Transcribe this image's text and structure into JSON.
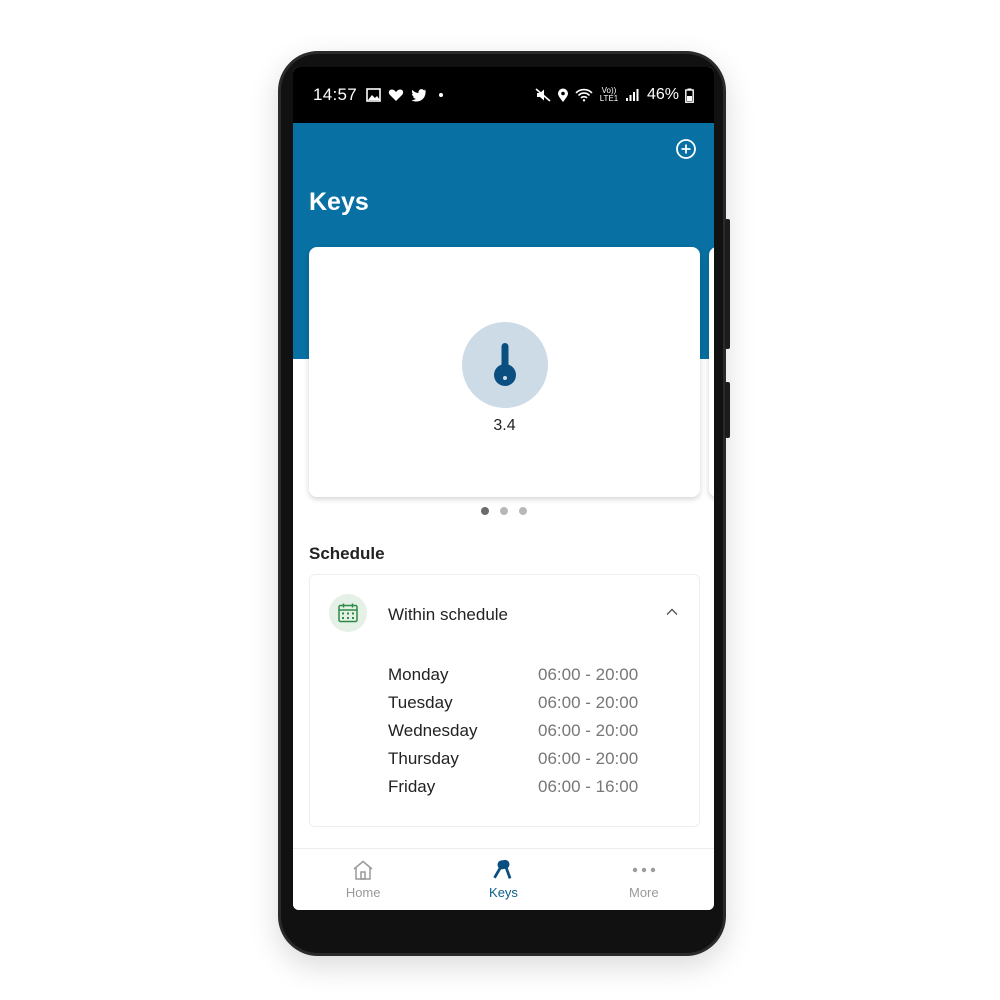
{
  "status_bar": {
    "time": "14:57",
    "battery": "46%",
    "network_label": "Vo)) LTE1"
  },
  "header": {
    "title": "Keys",
    "add_icon": "add-circle-icon",
    "background": "#0870a3"
  },
  "key_card": {
    "icon": "key-icon",
    "name": "3.4",
    "page_count": 3,
    "active_page": 1
  },
  "schedule": {
    "title": "Schedule",
    "status": "Within schedule",
    "status_icon": "calendar-icon",
    "expanded": true,
    "days": [
      {
        "day": "Monday",
        "hours": "06:00 - 20:00"
      },
      {
        "day": "Tuesday",
        "hours": "06:00 - 20:00"
      },
      {
        "day": "Wednesday",
        "hours": "06:00 - 20:00"
      },
      {
        "day": "Thursday",
        "hours": "06:00 - 20:00"
      },
      {
        "day": "Friday",
        "hours": "06:00 - 16:00"
      }
    ]
  },
  "bottom_nav": {
    "items": [
      {
        "label": "Home",
        "icon": "home-icon",
        "active": false
      },
      {
        "label": "Keys",
        "icon": "keys-icon",
        "active": true
      },
      {
        "label": "More",
        "icon": "more-icon",
        "active": false
      }
    ]
  },
  "colors": {
    "accent": "#0870a3",
    "key_icon": "#0b4f80",
    "key_circle": "#cddbe7",
    "calendar_green": "#2e8a45"
  }
}
